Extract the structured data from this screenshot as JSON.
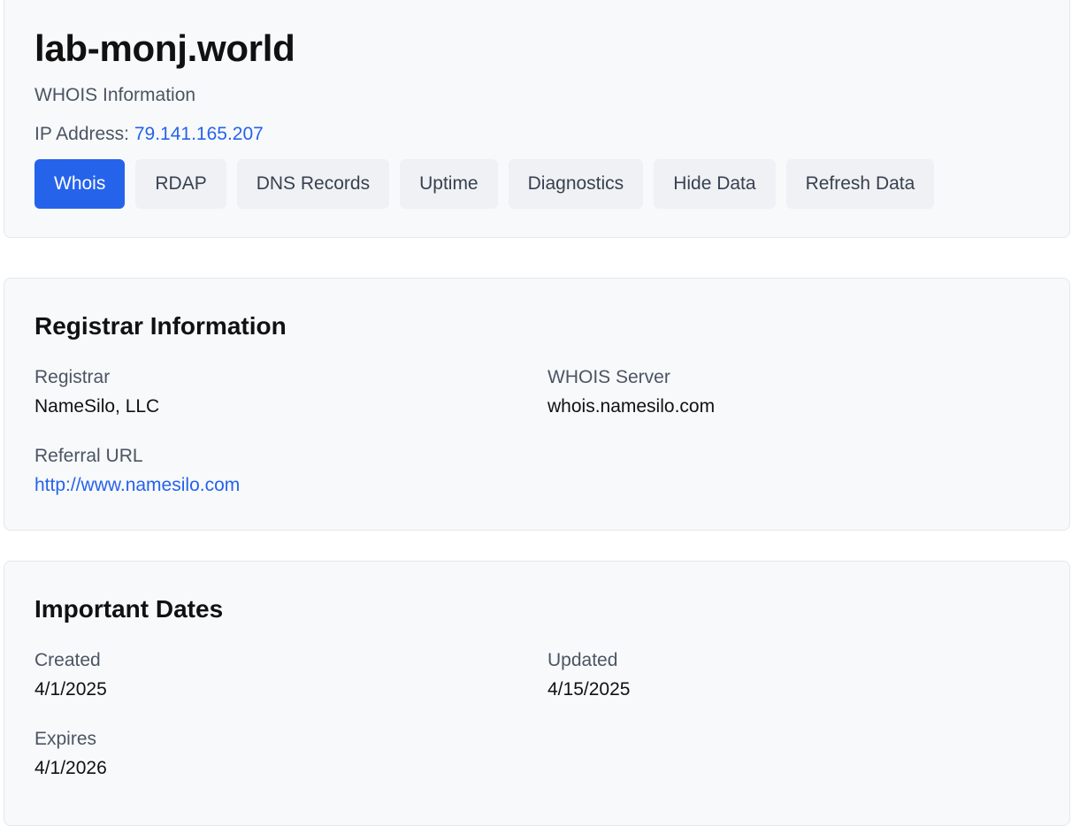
{
  "header": {
    "domain": "lab-monj.world",
    "subtitle": "WHOIS Information",
    "ip_label": "IP Address:",
    "ip_value": "79.141.165.207",
    "tabs": [
      {
        "label": "Whois",
        "active": true
      },
      {
        "label": "RDAP",
        "active": false
      },
      {
        "label": "DNS Records",
        "active": false
      },
      {
        "label": "Uptime",
        "active": false
      },
      {
        "label": "Diagnostics",
        "active": false
      },
      {
        "label": "Hide Data",
        "active": false
      },
      {
        "label": "Refresh Data",
        "active": false
      }
    ]
  },
  "registrar": {
    "title": "Registrar Information",
    "registrar_label": "Registrar",
    "registrar_value": "NameSilo, LLC",
    "whois_server_label": "WHOIS Server",
    "whois_server_value": "whois.namesilo.com",
    "referral_label": "Referral URL",
    "referral_value": "http://www.namesilo.com"
  },
  "dates": {
    "title": "Important Dates",
    "created_label": "Created",
    "created_value": "4/1/2025",
    "updated_label": "Updated",
    "updated_value": "4/15/2025",
    "expires_label": "Expires",
    "expires_value": "4/1/2026"
  },
  "colors": {
    "accent": "#2563eb",
    "card_bg": "#f8f9fb",
    "tab_bg": "#f0f1f4"
  }
}
